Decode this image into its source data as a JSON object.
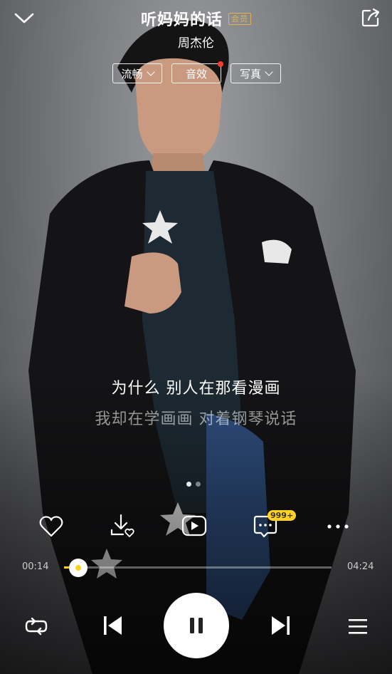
{
  "header": {
    "song_title": "听妈妈的话",
    "vip_badge": "会员",
    "artist": "周杰伦",
    "chips": [
      {
        "label": "流畅",
        "has_dropdown": true
      },
      {
        "label": "音效",
        "has_dropdown": false,
        "has_notification_dot": true
      },
      {
        "label": "写真",
        "has_dropdown": true
      }
    ]
  },
  "lyrics": {
    "current": "为什么 别人在那看漫画",
    "next": "我却在学画画 对着钢琴说话"
  },
  "pager": {
    "pages": 2,
    "active": 1
  },
  "actions": {
    "icons": [
      "heart-icon",
      "download-icon",
      "video-icon",
      "comment-icon",
      "more-icon"
    ],
    "comment_count": "999+"
  },
  "progress": {
    "elapsed": "00:14",
    "duration": "04:24",
    "fraction": 0.053
  },
  "controls": {
    "icons": [
      "repeat-icon",
      "previous-icon",
      "pause-icon",
      "next-icon",
      "playlist-icon"
    ]
  },
  "colors": {
    "accent": "#ffd21f",
    "vip": "#e1b24f",
    "notification": "#ff3b30"
  }
}
